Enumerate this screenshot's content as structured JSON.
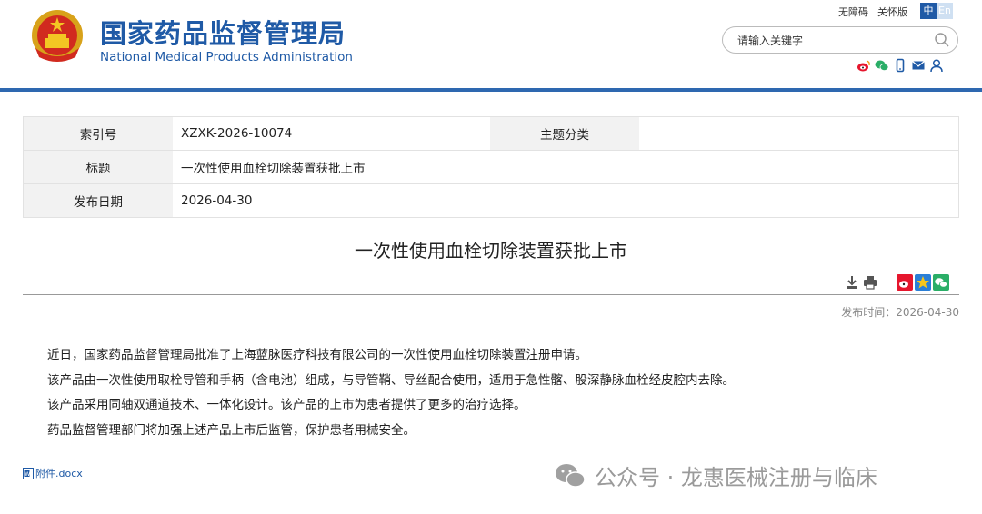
{
  "header": {
    "logo_cn": "国家药品监督管理局",
    "logo_en": "National Medical Products Administration",
    "links": [
      "无障碍",
      "关怀版"
    ],
    "lang": [
      "中",
      "En"
    ],
    "search_placeholder": "请输入关键字",
    "social_icons": [
      "weibo-icon",
      "wechat-icon",
      "mobile-icon",
      "mail-icon",
      "user-icon"
    ],
    "accent": "#1f5aa6"
  },
  "info_table": {
    "index_label": "索引号",
    "index_value": "XZXK-2026-10074",
    "category_label": "主题分类",
    "category_value": "",
    "title_label": "标题",
    "title_value": "一次性使用血栓切除装置获批上市",
    "date_label": "发布日期",
    "date_value": "2026-04-30"
  },
  "article": {
    "title": "一次性使用血栓切除装置获批上市",
    "publish_time": "发布时间：2026-04-30",
    "paragraphs": [
      "近日，国家药品监督管理局批准了上海蓝脉医疗科技有限公司的一次性使用血栓切除装置注册申请。",
      "该产品由一次性使用取栓导管和手柄（含电池）组成，与导管鞘、导丝配合使用，适用于急性髂、股深静脉血栓经皮腔内去除。",
      "该产品采用同轴双通道技术、一体化设计。该产品的上市为患者提供了更多的治疗选择。",
      "药品监督管理部门将加强上述产品上市后监管，保护患者用械安全。"
    ],
    "attachment": "附件.docx"
  },
  "watermark": "公众号 · 龙惠医械注册与临床"
}
